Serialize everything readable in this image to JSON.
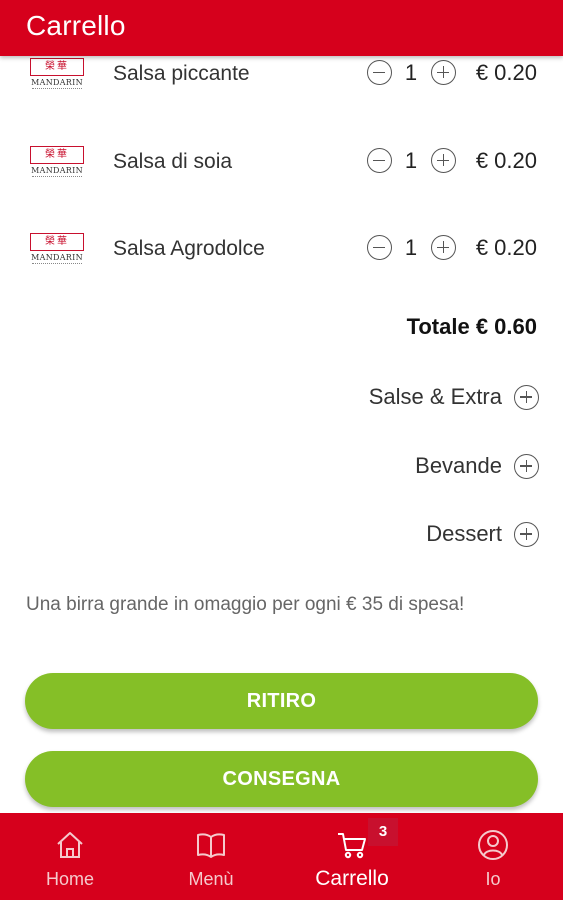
{
  "header": {
    "title": "Carrello"
  },
  "logo": {
    "mark": "榮華",
    "word": "MANDARIN"
  },
  "cart_items": [
    {
      "name": "Salsa piccante",
      "qty": "1",
      "price": "€ 0.20"
    },
    {
      "name": "Salsa di soia",
      "qty": "1",
      "price": "€ 0.20"
    },
    {
      "name": "Salsa Agrodolce",
      "qty": "1",
      "price": "€ 0.20"
    }
  ],
  "total": "Totale € 0.60",
  "categories": [
    {
      "label": "Salse & Extra",
      "icon": "plus-circle-icon"
    },
    {
      "label": "Bevande",
      "icon": "plus-circle-icon"
    },
    {
      "label": "Dessert",
      "icon": "plus-circle-icon"
    }
  ],
  "promo": "Una birra grande in omaggio per ogni € 35 di spesa!",
  "actions": {
    "pickup": "RITIRO",
    "delivery": "CONSEGNA"
  },
  "bottom_nav": {
    "items": [
      {
        "label": "Home",
        "icon": "home-icon"
      },
      {
        "label": "Menù",
        "icon": "book-icon"
      },
      {
        "label": "Carrello",
        "icon": "cart-icon"
      },
      {
        "label": "Io",
        "icon": "user-icon"
      }
    ],
    "active": "Carrello",
    "cart_badge": "3"
  },
  "colors": {
    "brand_red": "#d6001c",
    "action_green": "#85bf27"
  }
}
